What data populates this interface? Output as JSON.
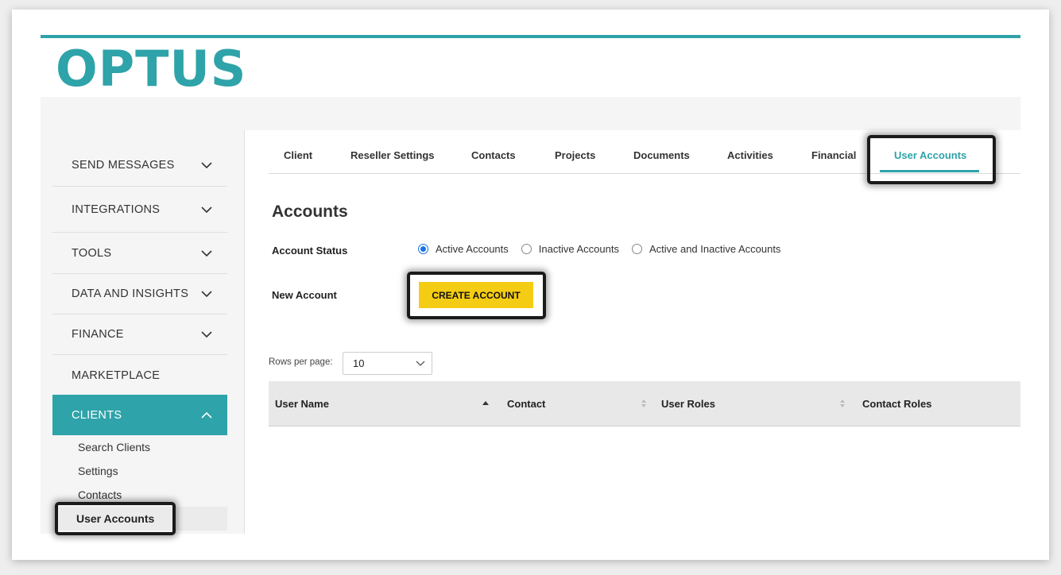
{
  "brand": {
    "logo_text": "OPTUS",
    "accent_color": "#2ea3a9",
    "button_color": "#f5cc14"
  },
  "sidebar": {
    "items": [
      {
        "label": "SEND MESSAGES",
        "icon": "chevron-down-icon"
      },
      {
        "label": "INTEGRATIONS",
        "icon": "chevron-down-icon"
      },
      {
        "label": "TOOLS",
        "icon": "chevron-down-icon"
      },
      {
        "label": "DATA AND INSIGHTS",
        "icon": "chevron-down-icon"
      },
      {
        "label": "FINANCE",
        "icon": "chevron-down-icon"
      },
      {
        "label": "MARKETPLACE"
      },
      {
        "label": "CLIENTS",
        "icon": "chevron-up-icon",
        "active": true
      }
    ],
    "sub_items": [
      "Search Clients",
      "Settings",
      "Contacts",
      "User Accounts"
    ]
  },
  "tabs": [
    "Client",
    "Reseller Settings",
    "Contacts",
    "Projects",
    "Documents",
    "Activities",
    "Financial",
    "User Accounts"
  ],
  "active_tab": "User Accounts",
  "main": {
    "heading": "Accounts",
    "account_status_label": "Account Status",
    "radio_options": [
      "Active Accounts",
      "Inactive Accounts",
      "Active and Inactive Accounts"
    ],
    "selected_radio": "Active Accounts",
    "new_account_label": "New Account",
    "create_button": "CREATE ACCOUNT",
    "rows_per_page_label": "Rows per page:",
    "rows_per_page_value": "10",
    "table_headers": [
      "User Name",
      "Contact",
      "User Roles",
      "Contact Roles"
    ]
  }
}
